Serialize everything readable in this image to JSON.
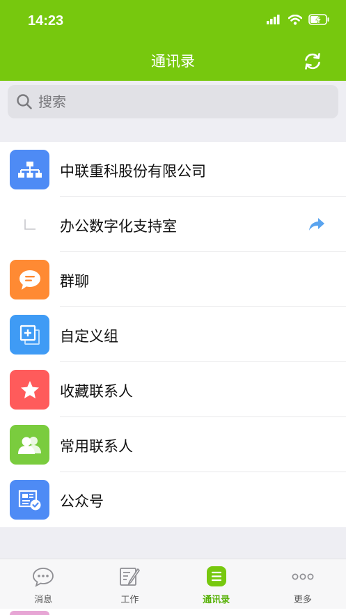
{
  "status_bar": {
    "time": "14:23"
  },
  "header": {
    "title": "通讯录"
  },
  "search": {
    "placeholder": "搜索"
  },
  "items": [
    {
      "label": "中联重科股份有限公司",
      "icon": "org-chart-icon",
      "color": "#4e8bf5"
    },
    {
      "label": "办公数字化支持室",
      "icon": "subdepartment-corner-icon",
      "color": "#ffffff"
    },
    {
      "label": "群聊",
      "icon": "chat-bubble-icon",
      "color": "#ff8a33"
    },
    {
      "label": "自定义组",
      "icon": "add-group-icon",
      "color": "#3f9bf5"
    },
    {
      "label": "收藏联系人",
      "icon": "star-icon",
      "color": "#ff5b5b"
    },
    {
      "label": "常用联系人",
      "icon": "contacts-icon",
      "color": "#7acc3e"
    },
    {
      "label": "公众号",
      "icon": "public-account-icon",
      "color": "#4e8bf5"
    }
  ],
  "tabs": [
    {
      "label": "消息",
      "icon": "message-icon"
    },
    {
      "label": "工作",
      "icon": "work-icon"
    },
    {
      "label": "通讯录",
      "icon": "contacts-book-icon",
      "active": true
    },
    {
      "label": "更多",
      "icon": "more-icon"
    }
  ],
  "colors": {
    "brand": "#77c80e",
    "active_tab": "#58b208"
  }
}
